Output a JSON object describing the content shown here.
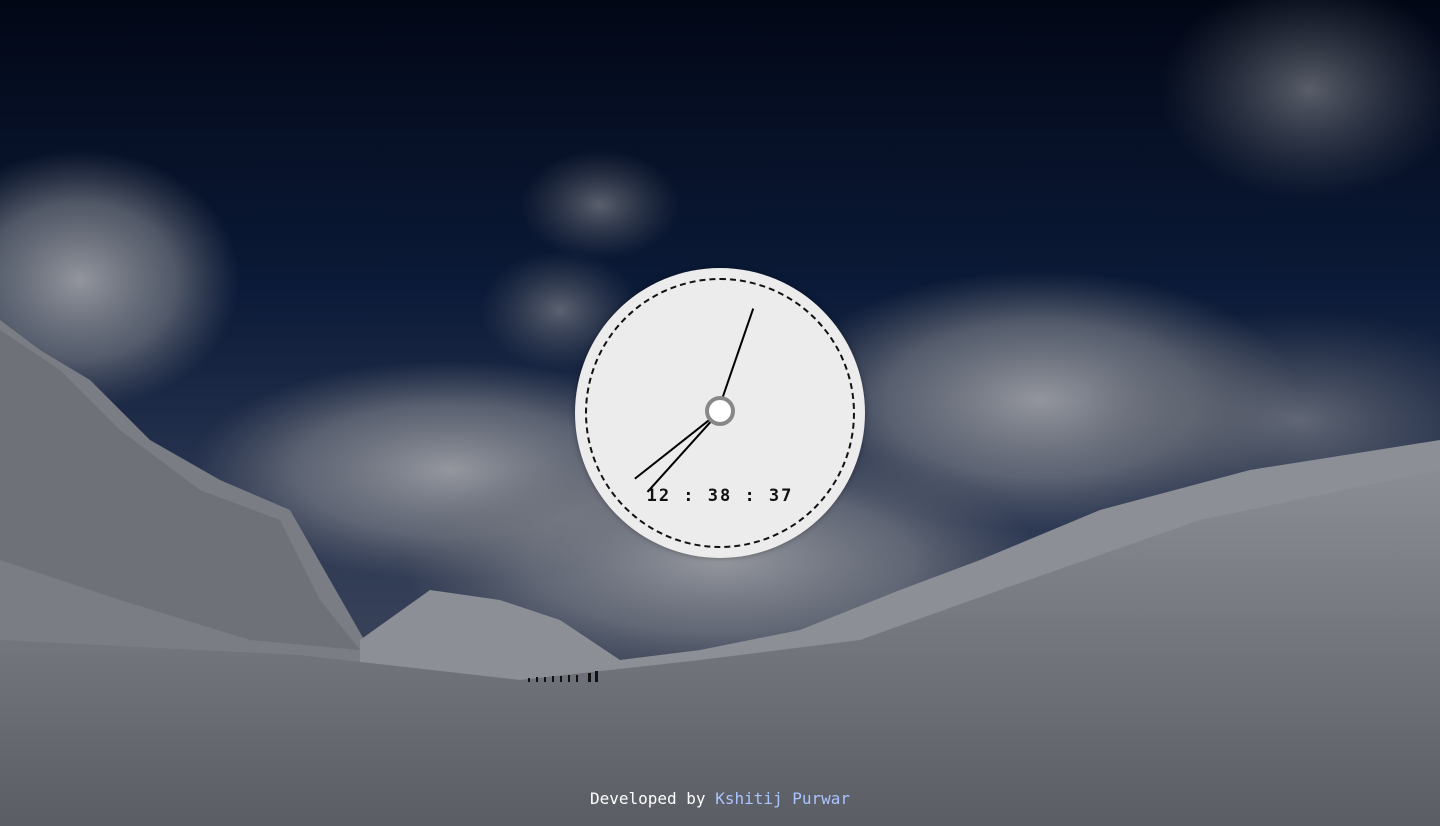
{
  "clock": {
    "digital_time": "12 : 38 : 37",
    "hours": 12,
    "minutes": 38,
    "seconds": 37
  },
  "footer": {
    "prefix": "Developed by",
    "author": "Kshitij Purwar"
  },
  "colors": {
    "sky_top": "#020716",
    "sky_mid": "#0d1c3c",
    "snow": "#6a6e76",
    "clock_face": "#ececec",
    "cap_ring": "#888888",
    "link": "#a9c4ff"
  }
}
